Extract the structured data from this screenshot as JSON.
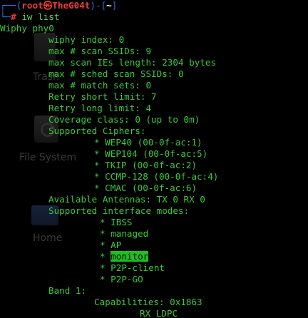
{
  "desktop": {
    "trash_label": "Trash",
    "file_system_label": "File System",
    "home_label": "Home"
  },
  "terminal": {
    "prompt": {
      "user": "root",
      "at": "㉿",
      "host": "TheG04t",
      "dir": "~",
      "command": "iw list"
    },
    "output": {
      "phy": "Wiphy phy0",
      "wiphy_index": "wiphy index: 0",
      "max_scan_ssids": "max # scan SSIDs: 9",
      "max_scan_ies": "max scan IEs length: 2304 bytes",
      "max_sched": "max # sched scan SSIDs: 0",
      "max_match": "max # match sets: 0",
      "retry_short": "Retry short limit: 7",
      "retry_long": "Retry long limit: 4",
      "coverage": "Coverage class: 0 (up to 0m)",
      "ciphers_header": "Supported Ciphers:",
      "ciphers": [
        "* WEP40 (00-0f-ac:1)",
        "* WEP104 (00-0f-ac:5)",
        "* TKIP (00-0f-ac:2)",
        "* CCMP-128 (00-0f-ac:4)",
        "* CMAC (00-0f-ac:6)"
      ],
      "antennas": "Available Antennas: TX 0 RX 0",
      "modes_header": "Supported interface modes:",
      "modes": [
        "IBSS",
        "managed",
        "AP",
        "monitor",
        "P2P-client",
        "P2P-GO"
      ],
      "mode_bullet": "* ",
      "band": "Band 1:",
      "capabilities": "Capabilities: 0x1863",
      "rx_ldpc": "RX LDPC"
    }
  }
}
